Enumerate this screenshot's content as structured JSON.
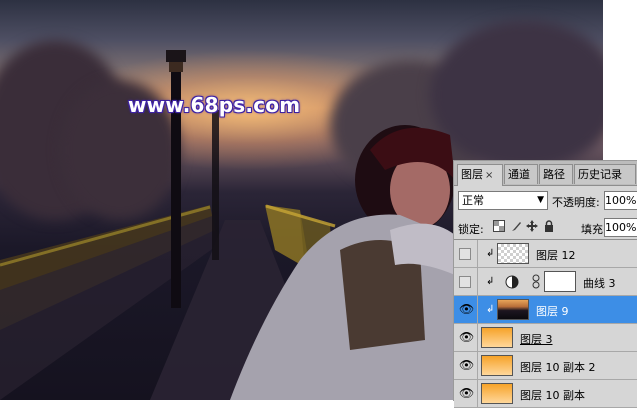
{
  "watermark": {
    "text": "www.68ps.com"
  },
  "panel": {
    "tabs": [
      {
        "label": "图层",
        "close": "×",
        "active": true
      },
      {
        "label": "通道"
      },
      {
        "label": "路径"
      },
      {
        "label": "历史记录"
      }
    ],
    "blend_mode": "正常",
    "opacity_label": "不透明度:",
    "opacity_value": "100%",
    "lock_label": "锁定:",
    "fill_label": "填充:",
    "fill_value": "100%",
    "layers": [
      {
        "name": "图层 12",
        "visible": false,
        "clipped": true,
        "thumb": "checker"
      },
      {
        "name": "曲线 3",
        "visible": false,
        "clipped": true,
        "thumb": "curves-adjustment"
      },
      {
        "name": "图层 9",
        "visible": true,
        "clipped": true,
        "selected": true,
        "thumb": "photo"
      },
      {
        "name": "图层 3",
        "visible": true,
        "thumb": "orange-gradient"
      },
      {
        "name": "图层 10 副本 2",
        "visible": true,
        "thumb": "orange-gradient"
      },
      {
        "name": "图层 10 副本",
        "visible": true,
        "thumb": "orange-gradient"
      }
    ]
  },
  "colors": {
    "selection": "#3d8ee6",
    "panel_bg": "#d6d6d6",
    "watermark_glow": "#3a1f9e"
  },
  "icons": [
    "eye-icon",
    "clip-arrow-icon",
    "curves-adjustment-icon",
    "link-chain-icon",
    "lock-transparent-icon",
    "lock-paint-icon",
    "lock-move-icon",
    "lock-all-icon",
    "dropdown-arrow-icon"
  ]
}
